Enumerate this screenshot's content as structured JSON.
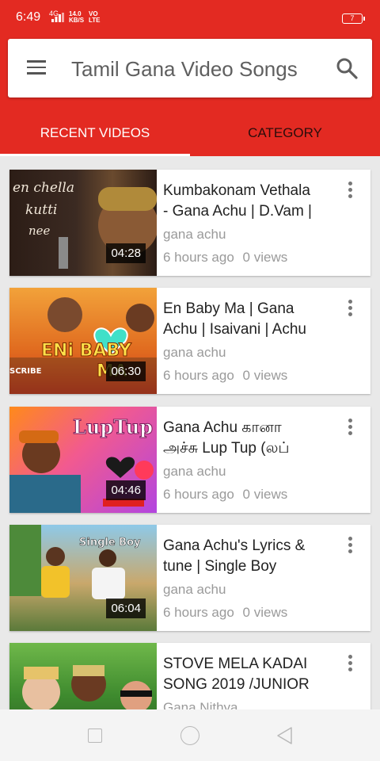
{
  "status_bar": {
    "time": "6:49",
    "signal": "4G",
    "speed_value": "14.0",
    "speed_unit": "KB/S",
    "network_top": "VO",
    "network_bottom": "LTE",
    "battery": "7"
  },
  "header": {
    "title": "Tamil Gana Video Songs"
  },
  "tabs": [
    {
      "label": "RECENT VIDEOS",
      "selected": true
    },
    {
      "label": "CATEGORY",
      "selected": false
    }
  ],
  "videos": [
    {
      "title_line1": "Kumbakonam Vethala",
      "title_line2": "- Gana Achu | D.Vam |",
      "channel": "gana achu",
      "age": "6 hours ago",
      "views": "0 views",
      "duration": "04:28",
      "thumb_text": "en chella kutti nee"
    },
    {
      "title_line1": "En Baby Ma | Gana",
      "title_line2": "Achu | Isaivani | Achu",
      "channel": "gana achu",
      "age": "6 hours ago",
      "views": "0 views",
      "duration": "06:30",
      "thumb_text": "ENi BABY MA"
    },
    {
      "title_line1": "Gana Achu கானா",
      "title_line2": "அச்சு Lup Tup (லப்",
      "channel": "gana achu",
      "age": "6 hours ago",
      "views": "0 views",
      "duration": "04:46",
      "thumb_text": "LupTup"
    },
    {
      "title_line1": "Gana Achu's Lyrics &",
      "title_line2": "tune | Single Boy",
      "channel": "gana achu",
      "age": "6 hours ago",
      "views": "0 views",
      "duration": "06:04",
      "thumb_text": "Single Boy"
    },
    {
      "title_line1": "STOVE MELA KADAI",
      "title_line2": "SONG 2019 /JUNIOR",
      "channel": "Gana Nithya",
      "age": "",
      "views": "",
      "duration": "",
      "thumb_text": ""
    }
  ],
  "icons": {
    "menu": "hamburger-icon",
    "search": "search-icon",
    "more": "more-vert-icon",
    "nav_recents": "square-icon",
    "nav_home": "circle-icon",
    "nav_back": "triangle-back-icon"
  },
  "colors": {
    "primary": "#e32a22",
    "tab_selected_text": "#ffffff",
    "tab_unselected_text": "#2b0d0b"
  }
}
